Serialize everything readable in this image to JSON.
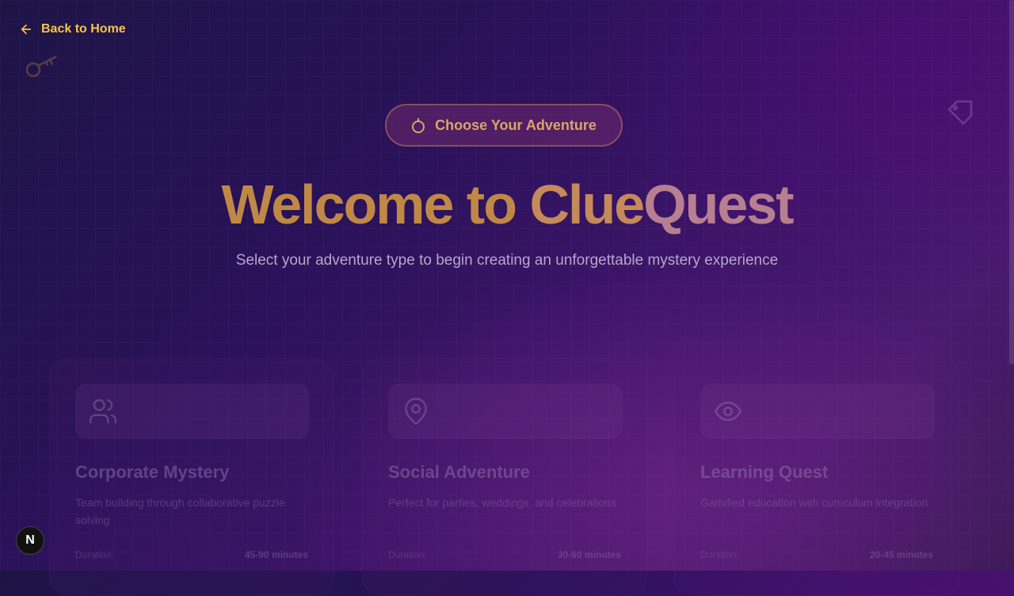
{
  "nav": {
    "back_label": "Back to Home"
  },
  "hero": {
    "pill_label": "Choose Your Adventure",
    "title_part1": "Welcome to",
    "title_part2": "Clue",
    "title_part3": "Quest",
    "subtitle": "Select your adventure type to begin creating an unforgettable mystery experience"
  },
  "cards": [
    {
      "icon": "users-icon",
      "title": "Corporate Mystery",
      "description": "Team building through collaborative puzzle solving",
      "duration_label": "Duration:",
      "duration_value": "45-90 minutes"
    },
    {
      "icon": "map-pin-icon",
      "title": "Social Adventure",
      "description": "Perfect for parties, weddings, and celebrations",
      "duration_label": "Duration:",
      "duration_value": "30-60 minutes"
    },
    {
      "icon": "eye-icon",
      "title": "Learning Quest",
      "description": "Gamified education with curriculum integration",
      "duration_label": "Duration:",
      "duration_value": "20-45 minutes"
    }
  ],
  "badge": {
    "letter": "N"
  },
  "colors": {
    "accent_gold": "#f3c54d",
    "title_gold": "#c08846",
    "title_pink": "#b77f90"
  }
}
